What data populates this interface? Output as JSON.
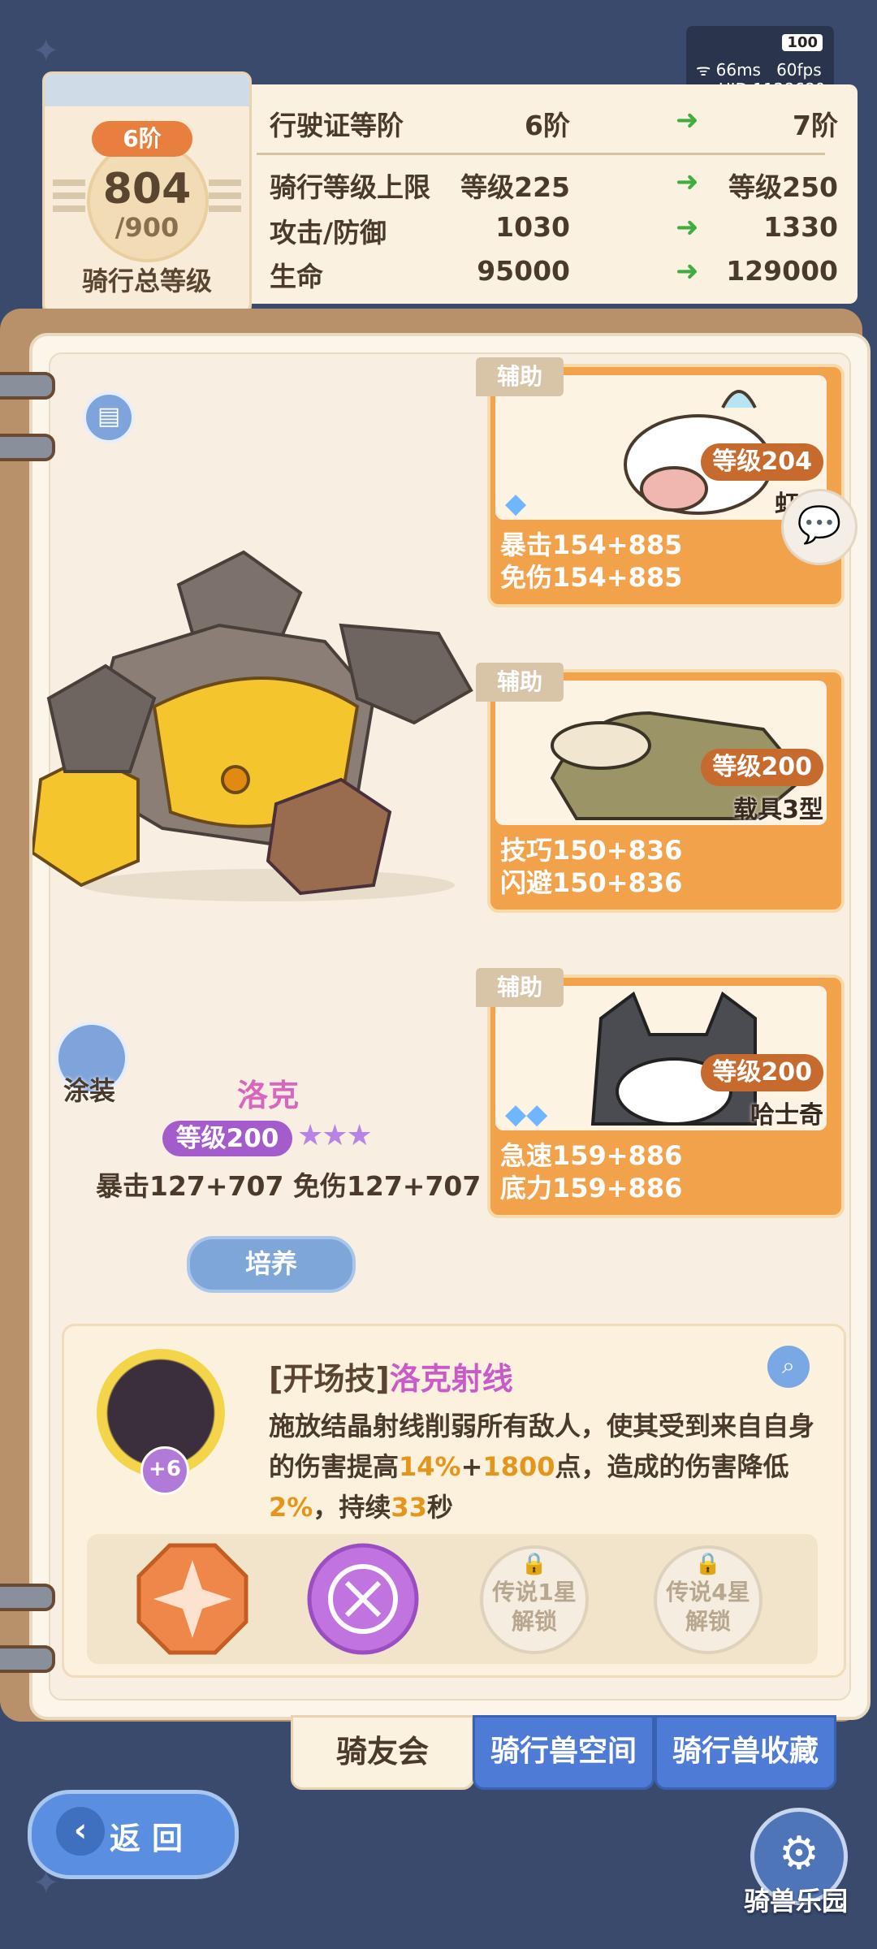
{
  "status": {
    "battery": "100",
    "ping": "66ms",
    "fps": "60fps",
    "uid": "UID 1128680"
  },
  "license": {
    "rank": "6阶",
    "total_level": "804",
    "max_level": "/900",
    "title": "骑行总等级"
  },
  "license_stats": [
    {
      "label": "行驶证等阶",
      "current": "6阶",
      "next": "7阶"
    },
    {
      "label": "骑行等级上限",
      "current": "等级225",
      "next": "等级250"
    },
    {
      "label": "攻击/防御",
      "current": "1030",
      "next": "1330"
    },
    {
      "label": "生命",
      "current": "95000",
      "next": "129000"
    }
  ],
  "supports": [
    {
      "tag": "辅助",
      "level": "等级204",
      "name": "虹光",
      "stat1": "暴击154+885",
      "stat2": "免伤154+885",
      "gems": "◆"
    },
    {
      "tag": "辅助",
      "level": "等级200",
      "name": "载具3型",
      "stat1": "技巧150+836",
      "stat2": "闪避150+836",
      "gems": ""
    },
    {
      "tag": "辅助",
      "level": "等级200",
      "name": "哈士奇",
      "stat1": "急速159+886",
      "stat2": "底力159+886",
      "gems": "◆◆"
    }
  ],
  "mount": {
    "skin_label": "涂装",
    "name": "洛克",
    "level": "等级200",
    "stars": "★★★",
    "stats": "暴击127+707  免伤127+707",
    "train_label": "培养"
  },
  "skill": {
    "plus": "+6",
    "bracket": "[开场技]",
    "name": "洛克射线",
    "desc_parts": [
      "施放结晶射线削弱所有敌人，使其受到来自自身的伤害提高",
      "14%",
      "+",
      "1800",
      "点，造成的伤害降低",
      "2%",
      "，持续",
      "33",
      "秒"
    ],
    "locked": [
      {
        "line1": "传说1星",
        "line2": "解锁"
      },
      {
        "line1": "传说4星",
        "line2": "解锁"
      }
    ]
  },
  "tabs": [
    "骑友会",
    "骑行兽空间",
    "骑行兽收藏"
  ],
  "back_label": "返回",
  "park_label": "骑兽乐园",
  "colors": {
    "accent_orange": "#f3a24c",
    "tab_blue": "#4d7bd6",
    "skill_name": "#c85bc8",
    "highlight": "#e4961a"
  }
}
